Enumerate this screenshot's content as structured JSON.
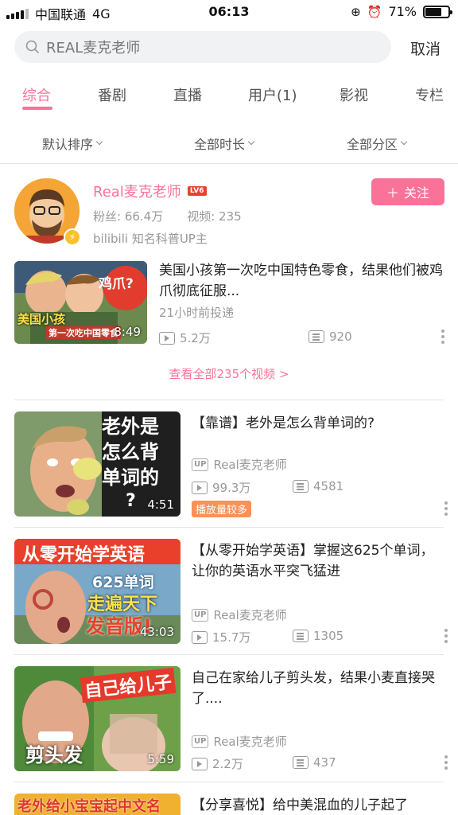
{
  "status_bar": {
    "carrier": "中国联通",
    "network": "4G",
    "time": "06:13",
    "battery": "71%",
    "battery_level": 0.71
  },
  "search": {
    "query": "REAL麦克老师",
    "cancel": "取消"
  },
  "tabs": [
    "综合",
    "番剧",
    "直播",
    "用户(1)",
    "影视",
    "专栏"
  ],
  "filters": [
    "默认排序",
    "全部时长",
    "全部分区"
  ],
  "user": {
    "name": "Real麦克老师",
    "level": "LV6",
    "fans": "粉丝: 66.4万",
    "videos": "视频: 235",
    "desc": "bilibili 知名科普UP主",
    "follow": "关注"
  },
  "featured": {
    "title": "美国小孩第一次吃中国特色零食，结果他们被鸡爪彻底征服...",
    "time": "21小时前投递",
    "duration": "8:49",
    "views": "5.2万",
    "danmaku": "920",
    "thumb_text_1": "鸡爪?",
    "thumb_text_2": "美国小孩",
    "thumb_text_3": "第一次吃中国零食"
  },
  "see_all": "查看全部235个视频 >",
  "videos": [
    {
      "title": "【靠谱】老外是怎么背单词的?",
      "uploader": "Real麦克老师",
      "views": "99.3万",
      "danmaku": "4581",
      "duration": "4:51",
      "badge": "播放量较多",
      "thumb_lines": [
        "老外是",
        "怎么背",
        "单词的",
        "?"
      ]
    },
    {
      "title": "【从零开始学英语】掌握这625个单词，让你的英语水平突飞猛进",
      "uploader": "Real麦克老师",
      "views": "15.7万",
      "danmaku": "1305",
      "duration": "43:03",
      "thumb_lines": [
        "从零开始学英语",
        "625单词",
        "走遍天下",
        "发音版!"
      ]
    },
    {
      "title": "自己在家给儿子剪头发，结果小麦直接哭了....",
      "uploader": "Real麦克老师",
      "views": "2.2万",
      "danmaku": "437",
      "duration": "5:59",
      "thumb_lines": [
        "自己给儿子",
        "剪头发"
      ]
    },
    {
      "title": "【分享喜悦】给中美混血的儿子起了",
      "thumb_lines": [
        "老外给小宝宝起中文名"
      ]
    }
  ]
}
